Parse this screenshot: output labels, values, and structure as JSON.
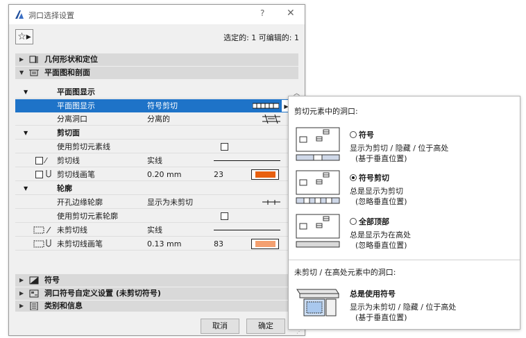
{
  "window": {
    "title": "洞口选择设置",
    "help": "?",
    "close": "✕"
  },
  "toolbar": {
    "favorites_glyph": "☆▸",
    "selection_info": "选定的: 1 可编辑的: 1"
  },
  "sections": {
    "geometry": "几何形状和定位",
    "plan_section": "平面图和剖面",
    "symbol": "符号",
    "custom": "洞口符号自定义设置 (未剪切符号)",
    "classification": "类别和信息"
  },
  "groups": {
    "plan_display": "平面图显示",
    "cut_surfaces": "剪切面",
    "outlines": "轮廓"
  },
  "rows": {
    "plan_display": {
      "label": "平面图显示",
      "value": "符号剪切"
    },
    "separate_opening": {
      "label": "分离洞口",
      "value": "分离的"
    },
    "use_cut_line": {
      "label": "使用剪切元素线"
    },
    "cut_line": {
      "label": "剪切线",
      "value": "实线"
    },
    "cut_line_pen": {
      "label": "剪切线画笔",
      "value": "0.20 mm",
      "pen": "23"
    },
    "opening_edge": {
      "label": "开孔边缘轮廓",
      "value": "显示为未剪切"
    },
    "use_cut_outline": {
      "label": "使用剪切元素轮廓"
    },
    "uncut_line": {
      "label": "未剪切线",
      "value": "实线"
    },
    "uncut_line_pen": {
      "label": "未剪切线画笔",
      "value": "0.13 mm",
      "pen": "83"
    }
  },
  "colors": {
    "pen23": "#e8600f",
    "pen83": "#f4a070",
    "selection": "#1e73c8"
  },
  "buttons": {
    "cancel": "取消",
    "ok": "确定"
  },
  "popup": {
    "header": "剪切元素中的洞口:",
    "options": [
      {
        "label": "符号",
        "line1": "显示为剪切 / 隐藏 / 位于高处",
        "line2": "(基于垂直位置)",
        "selected": false
      },
      {
        "label": "符号剪切",
        "line1": "总是显示为剪切",
        "line2": "(忽略垂直位置)",
        "selected": true
      },
      {
        "label": "全部顶部",
        "line1": "总是显示为在高处",
        "line2": "(忽略垂直位置)",
        "selected": false
      }
    ],
    "header2": "未剪切 / 在高处元素中的洞口:",
    "always": {
      "label": "总是使用符号",
      "line1": "显示为未剪切 / 隐藏 / 位于高处",
      "line2": "(基于垂直位置)"
    }
  }
}
